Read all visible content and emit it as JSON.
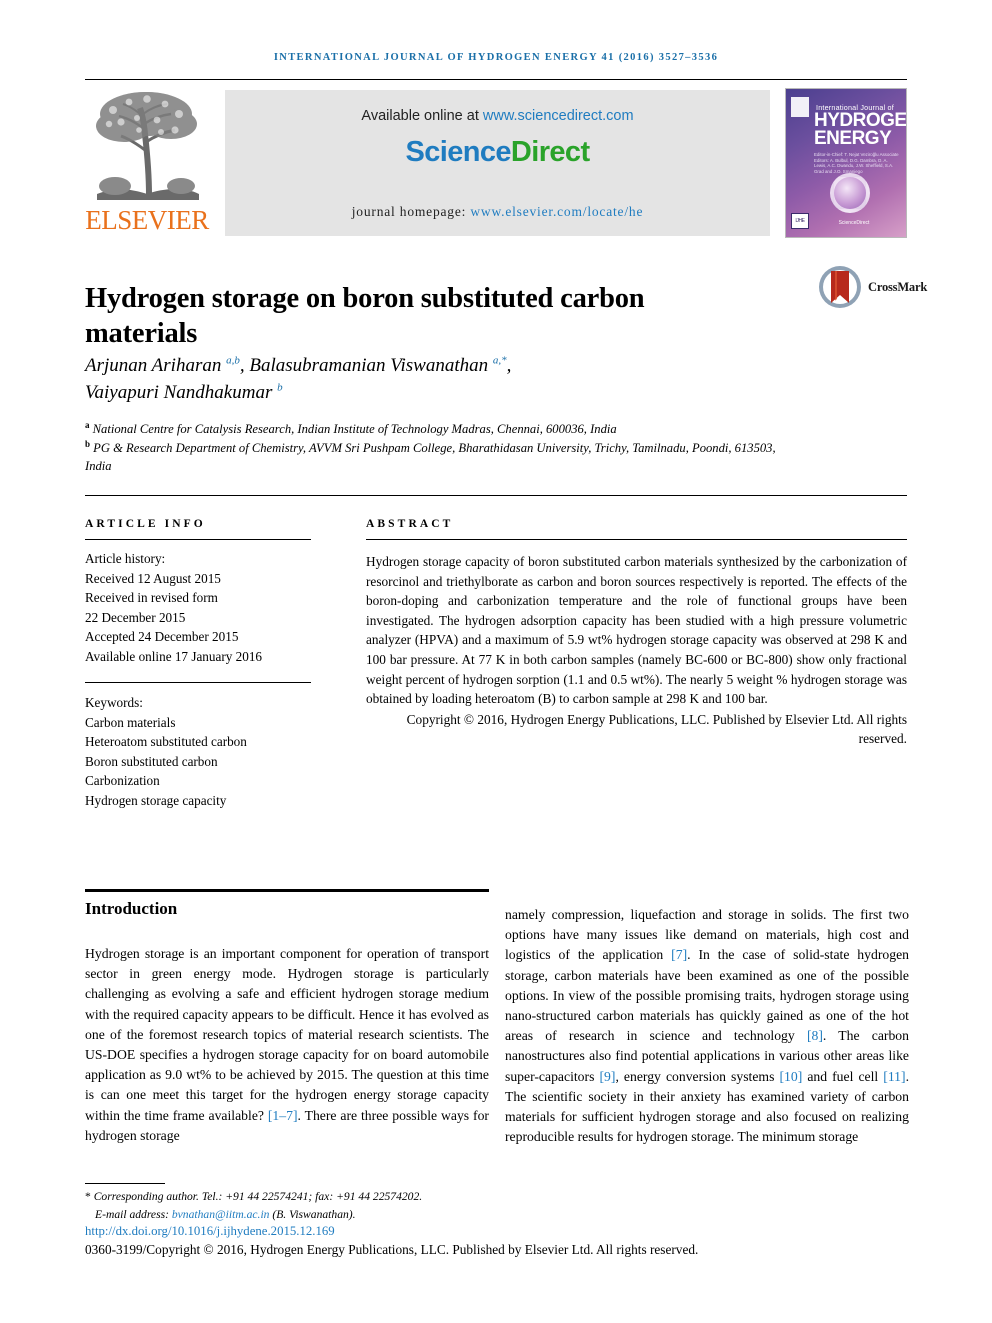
{
  "running_head": "International Journal of Hydrogen Energy 41 (2016) 3527–3536",
  "masthead": {
    "publisher_name": "ELSEVIER",
    "publisher_logo_alt": "elsevier-tree-logo",
    "available_prefix": "Available online at ",
    "available_url": "www.sciencedirect.com",
    "sciencedirect_part1": "Science",
    "sciencedirect_part2": "Direct",
    "homepage_prefix": "journal homepage: ",
    "homepage_url": "www.elsevier.com/locate/he",
    "cover": {
      "line_small": "International Journal of",
      "line_big_1": "HYDROGEN",
      "line_big_2": "ENERGY",
      "editors": "Editor-in-Chief: T. Nejat Veziroğlu   Associate Editors: A. Bulbul, D.G. Dambra, D. A. Lewis, A.C. Dwandu, J.W. Sheffield, S.A. Grad and J.O. Smaniego",
      "sciencedirect_badge": "ScienceDirect",
      "badge_code": "IJHE"
    }
  },
  "article": {
    "title": "Hydrogen storage on boron substituted carbon materials",
    "crossmark_label": "CrossMark",
    "authors_html": "Arjunan Ariharan <sup>a,b</sup>, Balasubramanian Viswanathan <sup>a,*</sup>, Vaiyapuri Nandhakumar <sup>b</sup>",
    "authors_plain": "Arjunan Ariharan a,b, Balasubramanian Viswanathan a,*, Vaiyapuri Nandhakumar b",
    "affiliation_a": "National Centre for Catalysis Research, Indian Institute of Technology Madras, Chennai, 600036, India",
    "affiliation_b": "PG & Research Department of Chemistry, AVVM Sri Pushpam College, Bharathidasan University, Trichy, Tamilnadu, Poondi, 613503, India"
  },
  "info": {
    "heading": "ARTICLE INFO",
    "history_label": "Article history:",
    "history": [
      "Received 12 August 2015",
      "Received in revised form",
      "22 December 2015",
      "Accepted 24 December 2015",
      "Available online 17 January 2016"
    ],
    "keywords_label": "Keywords:",
    "keywords": [
      "Carbon materials",
      "Heteroatom substituted carbon",
      "Boron substituted carbon",
      "Carbonization",
      "Hydrogen storage capacity"
    ]
  },
  "abstract": {
    "heading": "ABSTRACT",
    "text": "Hydrogen storage capacity of boron substituted carbon materials synthesized by the carbonization of resorcinol and triethylborate as carbon and boron sources respectively is reported. The effects of the boron-doping and carbonization temperature and the role of functional groups have been investigated. The hydrogen adsorption capacity has been studied with a high pressure volumetric analyzer (HPVA) and a maximum of 5.9 wt% hydrogen storage capacity was observed at 298 K and 100 bar pressure. At 77 K in both carbon samples (namely BC-600 or BC-800) show only fractional weight percent of hydrogen sorption (1.1 and 0.5 wt%). The nearly 5 weight % hydrogen storage was obtained by loading heteroatom (B) to carbon sample at 298 K and 100 bar.",
    "copyright": "Copyright © 2016, Hydrogen Energy Publications, LLC. Published by Elsevier Ltd. All rights reserved."
  },
  "body": {
    "section_heading": "Introduction",
    "left_column": "Hydrogen storage is an important component for operation of transport sector in green energy mode. Hydrogen storage is particularly challenging as evolving a safe and efficient hydrogen storage medium with the required capacity appears to be difficult. Hence it has evolved as one of the foremost research topics of material research scientists. The US-DOE specifies a hydrogen storage capacity for on board automobile application as 9.0 wt% to be achieved by 2015. The question at this time is can one meet this target for the hydrogen energy storage capacity within the time frame available? [1–7]. There are three possible ways for hydrogen storage",
    "left_column_pre_ref": "Hydrogen storage is an important component for operation of transport sector in green energy mode. Hydrogen storage is particularly challenging as evolving a safe and efficient hydrogen storage medium with the required capacity appears to be difficult. Hence it has evolved as one of the foremost research topics of material research scientists. The US-DOE specifies a hydrogen storage capacity for on board automobile application as 9.0 wt% to be achieved by 2015. The question at this time is can one meet this target for the hydrogen energy storage capacity within the time frame available? ",
    "left_ref_1": "[1–7]",
    "left_column_post_ref": ". There are three possible ways for hydrogen storage",
    "right_seg_1": "namely compression, liquefaction and storage in solids. The first two options have many issues like demand on materials, high cost and logistics of the application ",
    "right_ref_7": "[7]",
    "right_seg_2": ". In the case of solid-state hydrogen storage, carbon materials have been examined as one of the possible options. In view of the possible promising traits, hydrogen storage using nano-structured carbon materials has quickly gained as one of the hot areas of research in science and technology ",
    "right_ref_8": "[8]",
    "right_seg_3": ". The carbon nanostructures also find potential applications in various other areas like super-capacitors ",
    "right_ref_9": "[9]",
    "right_seg_4": ", energy conversion systems ",
    "right_ref_10": "[10]",
    "right_seg_5": " and fuel cell ",
    "right_ref_11": "[11]",
    "right_seg_6": ". The scientific society in their anxiety has examined variety of carbon materials for sufficient hydrogen storage and also focused on realizing reproducible results for hydrogen storage. The minimum storage"
  },
  "footer": {
    "corresponding_prefix": "Corresponding author. Tel.: +91 44 22574241; fax: +91 44 22574202.",
    "email_label": "E-mail address: ",
    "email": "bvnathan@iitm.ac.in",
    "email_suffix": " (B. Viswanathan).",
    "doi": "http://dx.doi.org/10.1016/j.ijhydene.2015.12.169",
    "copyright_line": "0360-3199/Copyright © 2016, Hydrogen Energy Publications, LLC. Published by Elsevier Ltd. All rights reserved."
  },
  "colors": {
    "link": "#1f7cc0",
    "running_head": "#1a6fa8",
    "elsevier_orange": "#e9711c",
    "sciencedirect_green": "#2aa32a",
    "crossmark_red": "#b7291c"
  }
}
